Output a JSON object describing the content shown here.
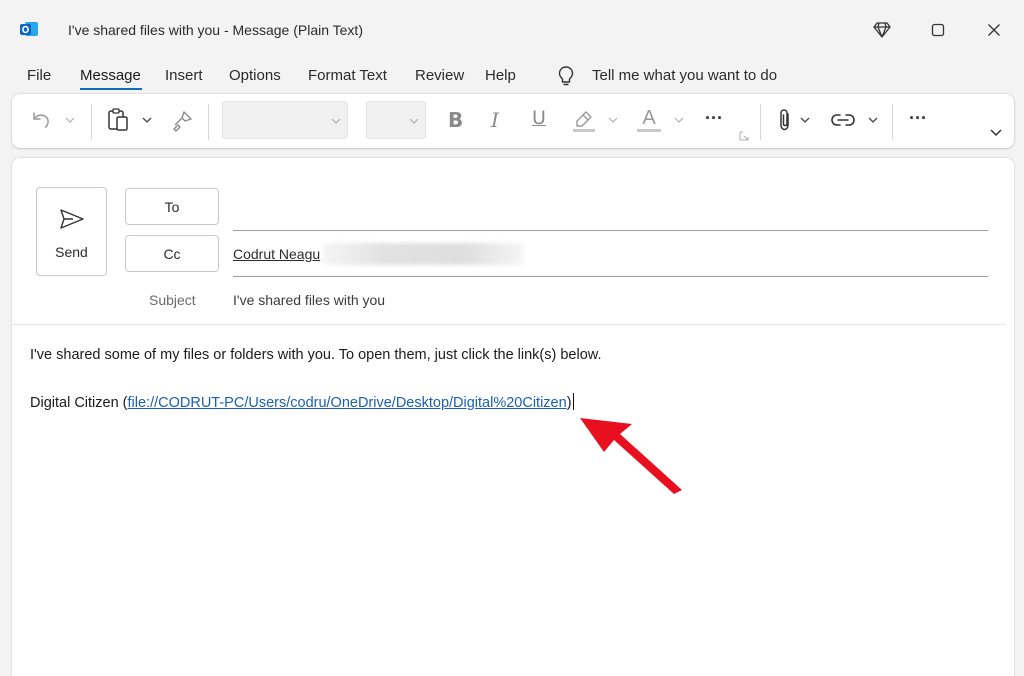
{
  "window": {
    "title": "I've shared files with you  -  Message (Plain Text)"
  },
  "menu": {
    "items": [
      "File",
      "Message",
      "Insert",
      "Options",
      "Format Text",
      "Review",
      "Help"
    ],
    "active": "Message",
    "tell_me": "Tell me what you want to do"
  },
  "ribbon": {
    "bold": "B",
    "italic": "I",
    "underline": "U",
    "font_color_letter": "A",
    "more": "···"
  },
  "compose": {
    "send_label": "Send",
    "to_label": "To",
    "cc_label": "Cc",
    "cc_value": "Codrut Neagu",
    "subject_label": "Subject",
    "subject_value": "I've shared files with you"
  },
  "body": {
    "line1": "I've shared some of my files or folders with you. To open them, just click the link(s) below.",
    "link_name": "Digital Citizen",
    "link_url": "file://CODRUT-PC/Users/codru/OneDrive/Desktop/Digital%20Citizen"
  },
  "colors": {
    "accent": "#0f6cbd",
    "link": "#1a5fb4",
    "annotation_arrow": "#e8101e",
    "outlook_icon": "#0a64c8"
  },
  "icons": {
    "app": "outlook-icon",
    "premium": "diamond-icon",
    "maximize": "maximize-icon",
    "close": "close-icon",
    "tell_me": "lightbulb-icon",
    "undo": "undo-icon",
    "paste": "clipboard-icon",
    "format_painter": "format-painter-icon",
    "highlight": "highlighter-icon",
    "attach": "paperclip-icon",
    "link": "link-icon",
    "send": "send-icon"
  }
}
